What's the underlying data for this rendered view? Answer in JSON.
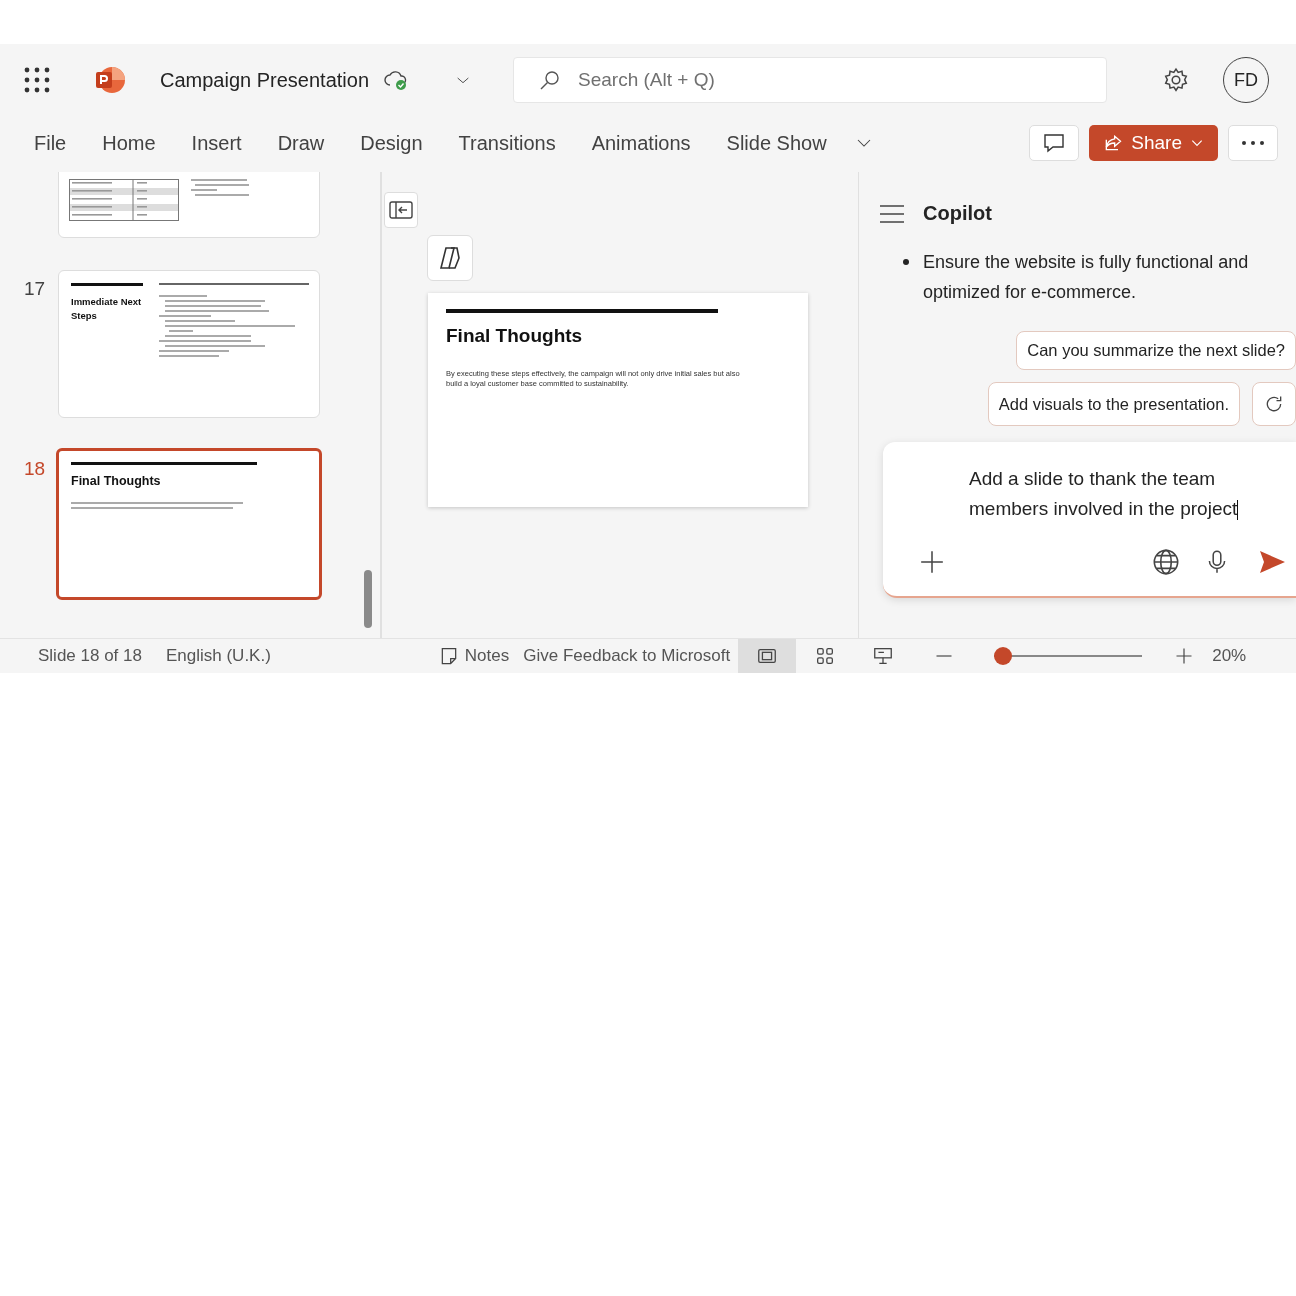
{
  "app_bar": {
    "title": "Campaign Presentation",
    "search": {
      "placeholder": "Search (Alt + Q)"
    },
    "avatar": "FD"
  },
  "ribbon": {
    "tabs": [
      {
        "label": "File",
        "selected": false
      },
      {
        "label": "Home",
        "selected": false
      },
      {
        "label": "Insert",
        "selected": false
      },
      {
        "label": "Draw",
        "selected": false
      },
      {
        "label": "Design",
        "selected": false
      },
      {
        "label": "Transitions",
        "selected": false
      },
      {
        "label": "Animations",
        "selected": false
      },
      {
        "label": "Slide Show",
        "selected": false
      }
    ],
    "share": "Share"
  },
  "thumbnails": [
    {
      "kind": "budget",
      "selected": false
    },
    {
      "kind": "steps",
      "number": "17",
      "selected": false,
      "title": "Immediate Next Steps"
    },
    {
      "kind": "text",
      "number": "18",
      "selected": true,
      "title": "Final Thoughts"
    }
  ],
  "slide": {
    "title": "Final Thoughts",
    "body": "By executing these steps effectively, the campaign will not only drive initial sales but also build a loyal customer base committed to sustainability."
  },
  "copilot": {
    "title": "Copilot",
    "bullets": [
      "Ensure the website is fully functional and optimized for e-commerce."
    ],
    "suggestions": [
      "Can you summarize the next slide?",
      "Add visuals to the presentation."
    ],
    "input": "Add a slide to thank the team members involved in the project"
  },
  "status_bar": {
    "slide_info": "Slide 18 of 18",
    "language": "English (U.K.)",
    "notes": "Notes",
    "feedback": "Give Feedback to Microsoft",
    "views": [
      {
        "kind": "normal",
        "selected": true
      },
      {
        "kind": "sorter",
        "selected": false
      },
      {
        "kind": "presenter",
        "selected": false
      }
    ],
    "zoom": {
      "level": 0.0,
      "reading": "20%"
    }
  }
}
